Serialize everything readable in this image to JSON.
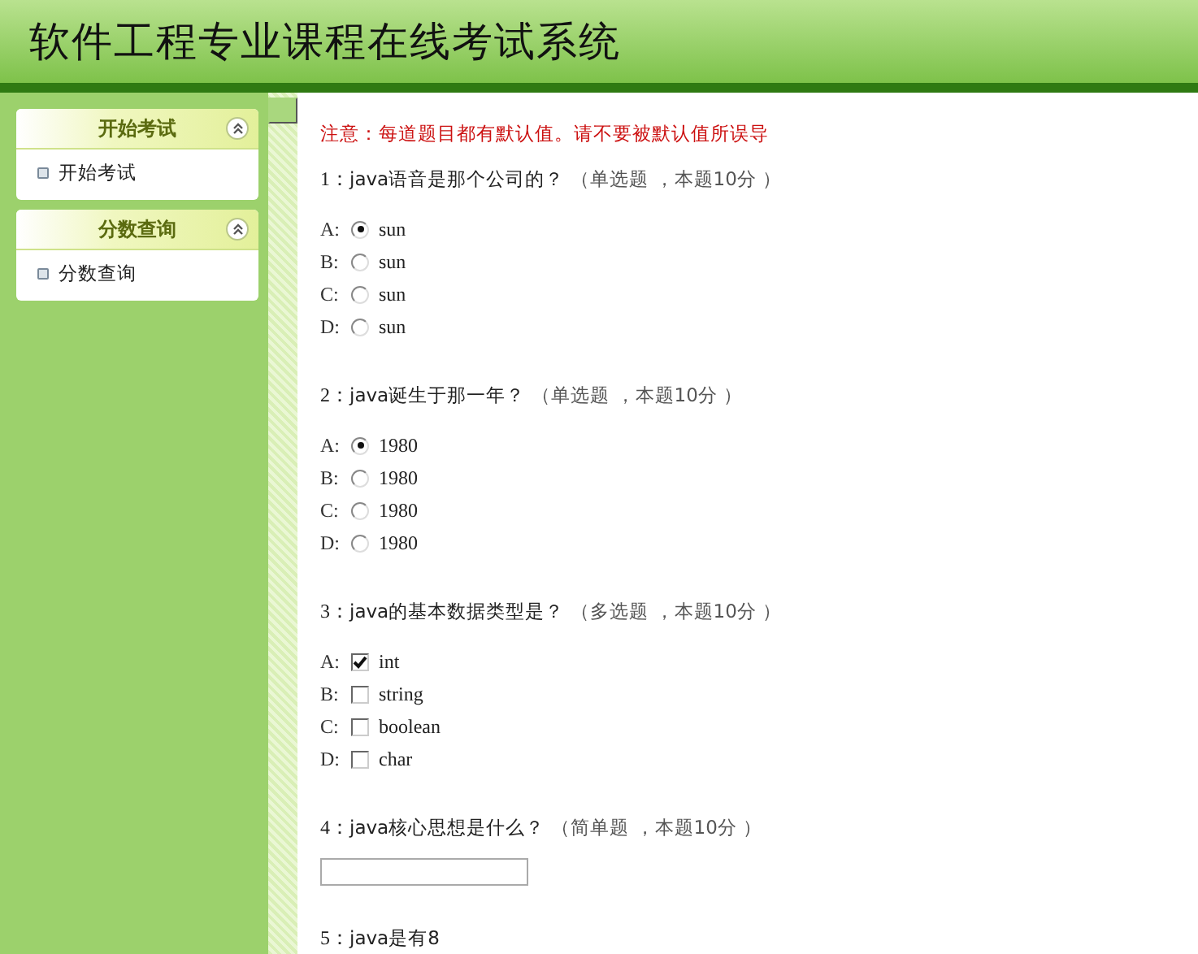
{
  "header": {
    "title": "软件工程专业课程在线考试系统"
  },
  "sidebar": {
    "panels": [
      {
        "title": "开始考试",
        "expanded": true,
        "items": [
          "开始考试"
        ]
      },
      {
        "title": "分数查询",
        "expanded": true,
        "items": [
          "分数查询"
        ]
      }
    ]
  },
  "notice": "注意：每道题目都有默认值。请不要被默认值所误导",
  "questions": [
    {
      "number": "1：",
      "text": "java语音是那个公司的？",
      "meta": "（单选题 ，本题10分 ）",
      "kind": "radio",
      "options": [
        {
          "letter": "A:",
          "label": "sun",
          "selected": true
        },
        {
          "letter": "B:",
          "label": "sun",
          "selected": false
        },
        {
          "letter": "C:",
          "label": "sun",
          "selected": false
        },
        {
          "letter": "D:",
          "label": "sun",
          "selected": false
        }
      ]
    },
    {
      "number": "2：",
      "text": "java诞生于那一年？",
      "meta": "（单选题 ，本题10分 ）",
      "kind": "radio",
      "options": [
        {
          "letter": "A:",
          "label": "1980",
          "selected": true
        },
        {
          "letter": "B:",
          "label": "1980",
          "selected": false
        },
        {
          "letter": "C:",
          "label": "1980",
          "selected": false
        },
        {
          "letter": "D:",
          "label": "1980",
          "selected": false
        }
      ]
    },
    {
      "number": "3：",
      "text": "java的基本数据类型是？",
      "meta": "（多选题 ，本题10分 ）",
      "kind": "checkbox",
      "options": [
        {
          "letter": "A:",
          "label": "int",
          "checked": true
        },
        {
          "letter": "B:",
          "label": "string",
          "checked": false
        },
        {
          "letter": "C:",
          "label": "boolean",
          "checked": false
        },
        {
          "letter": "D:",
          "label": "char",
          "checked": false
        }
      ]
    },
    {
      "number": "4：",
      "text": "java核心思想是什么？",
      "meta": "（简单题 ，本题10分 ）",
      "kind": "text"
    },
    {
      "number": "5：",
      "text": "java是有8",
      "kind": "partial"
    }
  ]
}
